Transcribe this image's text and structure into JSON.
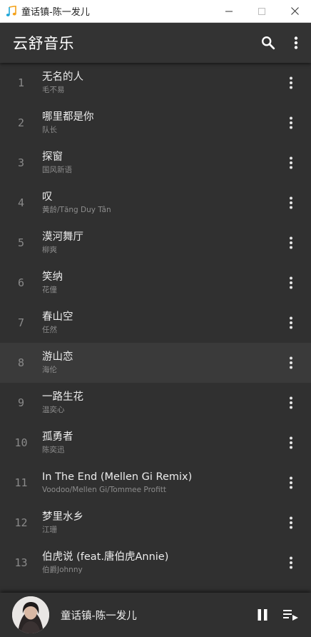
{
  "window": {
    "title": "童话镇-陈一发儿",
    "icon": "music-note-icon"
  },
  "appbar": {
    "title": "云舒音乐",
    "search_icon": "search-icon",
    "menu_icon": "more-vert-icon"
  },
  "songs": [
    {
      "num": "1",
      "title": "无名的人",
      "artist": "毛不易"
    },
    {
      "num": "2",
      "title": "哪里都是你",
      "artist": "队长"
    },
    {
      "num": "3",
      "title": "探窗",
      "artist": "国风新语"
    },
    {
      "num": "4",
      "title": "叹",
      "artist": "黄龄/Tăng Duy Tân"
    },
    {
      "num": "5",
      "title": "漠河舞厅",
      "artist": "柳爽"
    },
    {
      "num": "6",
      "title": "笑纳",
      "artist": "花僮"
    },
    {
      "num": "7",
      "title": "春山空",
      "artist": "任然"
    },
    {
      "num": "8",
      "title": "游山恋",
      "artist": "海伦"
    },
    {
      "num": "9",
      "title": "一路生花",
      "artist": "温奕心"
    },
    {
      "num": "10",
      "title": "孤勇者",
      "artist": "陈奕迅"
    },
    {
      "num": "11",
      "title": "In The End (Mellen Gi Remix)",
      "artist": "Voodoo/Mellen Gi/Tommee Profitt"
    },
    {
      "num": "12",
      "title": "梦里水乡",
      "artist": "江珊"
    },
    {
      "num": "13",
      "title": "伯虎说 (feat.唐伯虎Annie)",
      "artist": "伯爵Johnny"
    }
  ],
  "active_index": 7,
  "player": {
    "now_playing": "童话镇-陈一发儿",
    "play_state": "playing",
    "pause_icon": "pause-icon",
    "queue_icon": "playlist-play-icon"
  },
  "colors": {
    "background": "#303030",
    "appbar": "#333333",
    "active_row": "#3a3a3a",
    "text_primary": "#ececec",
    "text_secondary": "#8d8d8d"
  }
}
